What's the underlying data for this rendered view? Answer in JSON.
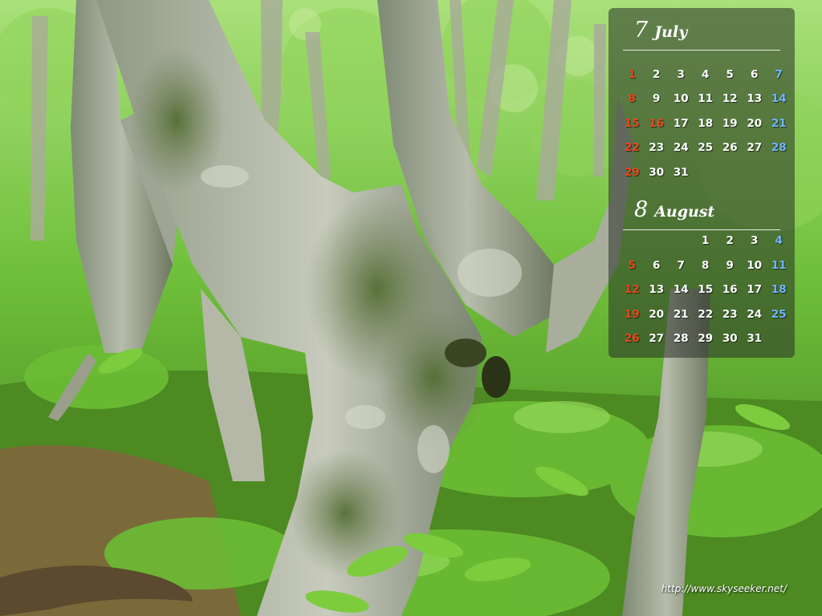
{
  "calendar": {
    "months": [
      {
        "number": "7",
        "name": "July",
        "days": [
          "",
          "",
          "",
          "",
          "",
          "",
          "",
          "1",
          "2",
          "3",
          "4",
          "5",
          "6",
          "7",
          "8",
          "9",
          "10",
          "11",
          "12",
          "13",
          "14",
          "15",
          "16",
          "17",
          "18",
          "19",
          "20",
          "21",
          "22",
          "23",
          "24",
          "25",
          "26",
          "27",
          "28",
          "29",
          "30",
          "31",
          "",
          "",
          "",
          ""
        ],
        "red_days": [
          "1",
          "8",
          "15",
          "16",
          "22",
          "29"
        ],
        "blue_days": [
          "7",
          "14",
          "21",
          "28"
        ]
      },
      {
        "number": "8",
        "name": "August",
        "days": [
          "",
          "",
          "",
          "1",
          "2",
          "3",
          "4",
          "5",
          "6",
          "7",
          "8",
          "9",
          "10",
          "11",
          "12",
          "13",
          "14",
          "15",
          "16",
          "17",
          "18",
          "19",
          "20",
          "21",
          "22",
          "23",
          "24",
          "25",
          "26",
          "27",
          "28",
          "29",
          "30",
          "31",
          ""
        ],
        "red_days": [
          "5",
          "12",
          "19",
          "26"
        ],
        "blue_days": [
          "4",
          "11",
          "18",
          "25"
        ]
      }
    ]
  },
  "credit": {
    "url": "http://www.skyseeker.net/"
  },
  "colors": {
    "sunday_holiday": "#e8481e",
    "saturday": "#6fb6ff",
    "text": "#ffffff",
    "foliage": "#6fbf3a"
  }
}
